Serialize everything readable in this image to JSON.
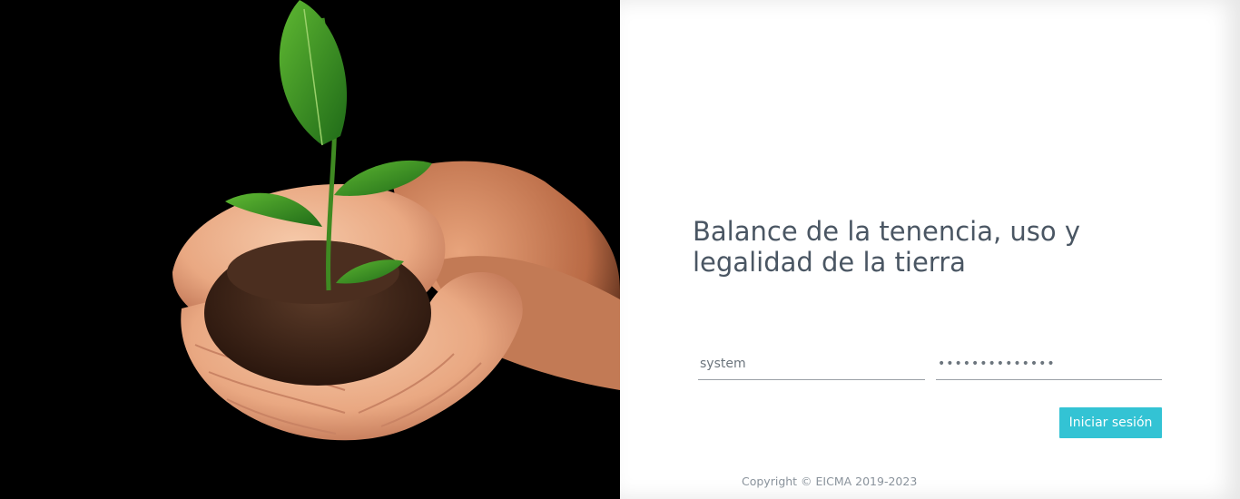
{
  "hero": {
    "image_name": "plant-sprout-in-hands-image"
  },
  "login": {
    "title": "Balance de la tenencia, uso y legalidad de la tierra",
    "username_value": "system",
    "password_value": "••••••••••••••",
    "submit_label": "Iniciar sesión"
  },
  "footer": {
    "copyright": "Copyright © EICMA 2019-2023"
  },
  "colors": {
    "accent": "#33c3d4",
    "title_text": "#4a5663",
    "muted_text": "#8a939c"
  }
}
